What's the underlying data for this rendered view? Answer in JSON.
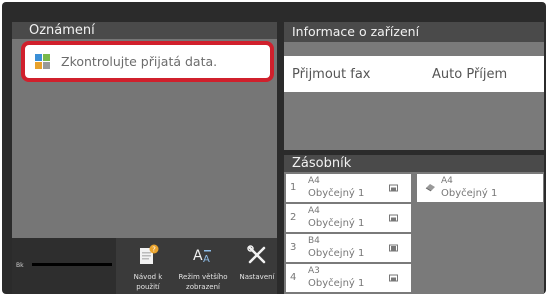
{
  "notifications": {
    "header": "Oznámení",
    "item": "Zkontrolujte přijatá data."
  },
  "device_info": {
    "header": "Informace o zařízení",
    "row_label": "Přijmout fax",
    "row_value": "Auto Příjem"
  },
  "trays": {
    "header": "Zásobník",
    "items": [
      {
        "number": "1",
        "size": "A4",
        "type": "Obyčejný 1"
      },
      {
        "number": "2",
        "size": "A4",
        "type": "Obyčejný 1"
      },
      {
        "number": "3",
        "size": "B4",
        "type": "Obyčejný 1"
      },
      {
        "number": "4",
        "size": "A3",
        "type": "Obyčejný 1"
      }
    ],
    "bypass": {
      "size": "A4",
      "type": "Obyčejný 1"
    }
  },
  "toner": {
    "label": "Bk"
  },
  "toolbar": {
    "items": [
      {
        "label": "Návod k použití",
        "icon": "manual-icon"
      },
      {
        "label": "Režim většího zobrazení",
        "icon": "large-text-icon"
      },
      {
        "label": "Nastavení",
        "icon": "settings-tools-icon"
      }
    ]
  },
  "colors": {
    "highlight": "#d0202c",
    "panel": "#7a7a7a",
    "header": "#4a4a4a",
    "background": "#2b2b2b"
  }
}
